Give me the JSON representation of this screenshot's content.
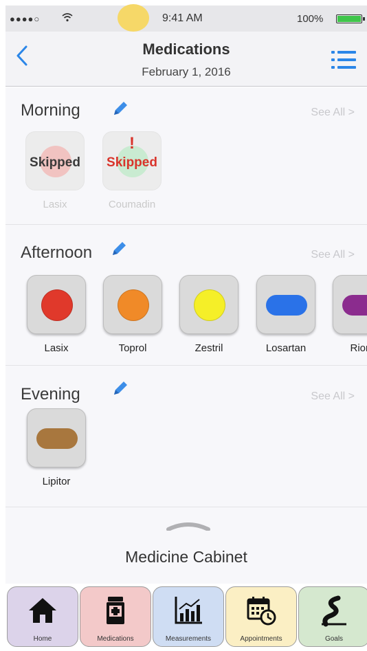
{
  "status_bar": {
    "signal": "●●●●○",
    "wifi": "▿",
    "time": "9:41 AM",
    "battery": "100%",
    "battery_color": "#3fc54a"
  },
  "nav": {
    "back_icon": "chevron-left-icon",
    "title": "Medications",
    "subtitle": "February 1, 2016",
    "menu_icon": "list-icon",
    "accent": "#2b86e8"
  },
  "sections": {
    "morning": {
      "title": "Morning",
      "see_all": "See All >",
      "meds": [
        {
          "name": "Lasix",
          "status": "Skipped",
          "alert": "",
          "pill_color": "#f1b7b5"
        },
        {
          "name": "Coumadin",
          "status": "Skipped",
          "alert": "!",
          "pill_color": "#bfe6c8"
        }
      ]
    },
    "afternoon": {
      "title": "Afternoon",
      "see_all": "See All >",
      "meds": [
        {
          "name": "Lasix",
          "shape": "round",
          "color": "#e0392b"
        },
        {
          "name": "Toprol",
          "shape": "round",
          "color": "#f08a28"
        },
        {
          "name": "Zestril",
          "shape": "round",
          "color": "#f5ef28"
        },
        {
          "name": "Losartan",
          "shape": "oval",
          "color": "#2a72e8"
        },
        {
          "name": "Riom",
          "shape": "oval",
          "color": "#8b2c8e"
        }
      ]
    },
    "evening": {
      "title": "Evening",
      "see_all": "See All >",
      "meds": [
        {
          "name": "Lipitor",
          "shape": "oval",
          "color": "#a8773e"
        }
      ]
    }
  },
  "cabinet": {
    "label": "Medicine Cabinet"
  },
  "tabs": [
    {
      "label": "Home",
      "icon": "home-icon",
      "color": "#dcd3ea"
    },
    {
      "label": "Medications",
      "icon": "pill-bottle-icon",
      "color": "#f3c9c9"
    },
    {
      "label": "Measurements",
      "icon": "bar-chart-icon",
      "color": "#cfddf3"
    },
    {
      "label": "Appointments",
      "icon": "calendar-clock-icon",
      "color": "#fbefc4"
    },
    {
      "label": "Goals",
      "icon": "winding-road-icon",
      "color": "#d5e8cf"
    }
  ]
}
